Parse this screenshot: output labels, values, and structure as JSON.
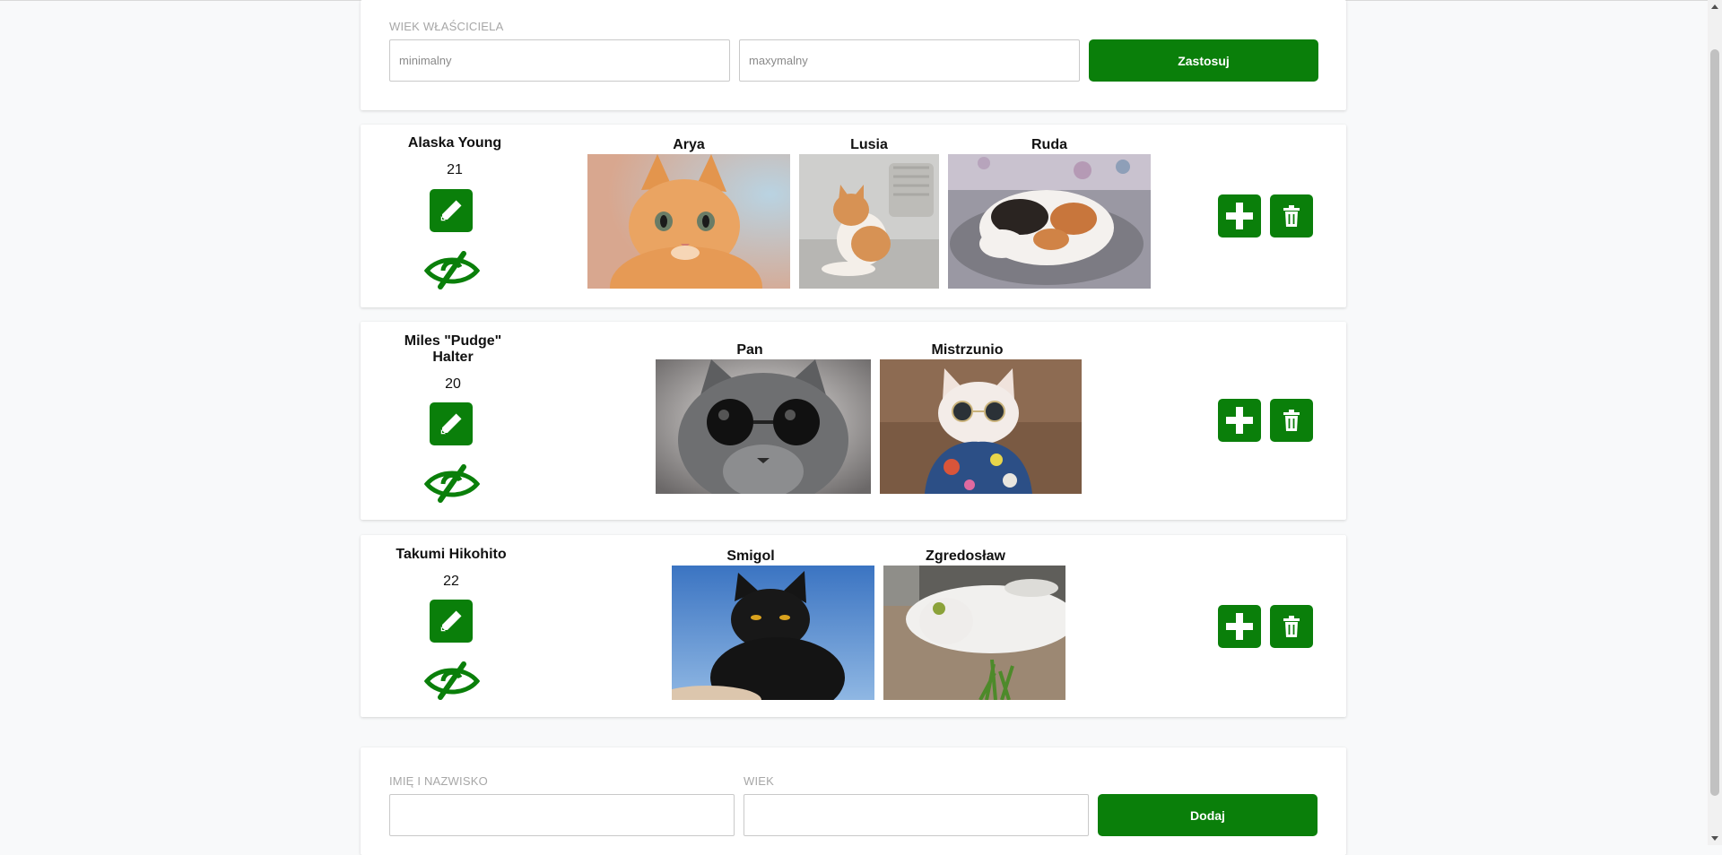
{
  "filter": {
    "label": "WIEK WŁAŚCICIELA",
    "min_placeholder": "minimalny",
    "max_placeholder": "maxymalny",
    "apply_label": "Zastosuj"
  },
  "owners": [
    {
      "name": "Alaska Young",
      "age": "21",
      "cats": [
        {
          "name": "Arya",
          "photo": "orange-kitten"
        },
        {
          "name": "Lusia",
          "photo": "ginger-white-cat-on-sofa"
        },
        {
          "name": "Ruda",
          "photo": "calico-cat-sleeping"
        }
      ]
    },
    {
      "name": "Miles \"Pudge\" Halter",
      "age": "20",
      "cats": [
        {
          "name": "Pan",
          "photo": "grey-cat-with-sunglasses"
        },
        {
          "name": "Mistrzunio",
          "photo": "white-cat-with-sunglasses-and-shirt"
        }
      ]
    },
    {
      "name": "Takumi Hikohito",
      "age": "22",
      "cats": [
        {
          "name": "Smigol",
          "photo": "black-cat-blue-sky"
        },
        {
          "name": "Zgredosław",
          "photo": "white-cat-lying-on-ground"
        }
      ]
    }
  ],
  "add_form": {
    "name_label": "IMIĘ I NAZWISKO",
    "age_label": "WIEK",
    "name_value": "",
    "age_value": "",
    "add_label": "Dodaj"
  },
  "icons": {
    "edit": "pencil-icon",
    "visibility": "eye-slash-icon",
    "add": "plus-icon",
    "delete": "trash-icon"
  },
  "colors": {
    "accent": "#0a7f0a",
    "background": "#f8f9fa",
    "card": "#ffffff",
    "label": "#a7a7a7"
  }
}
